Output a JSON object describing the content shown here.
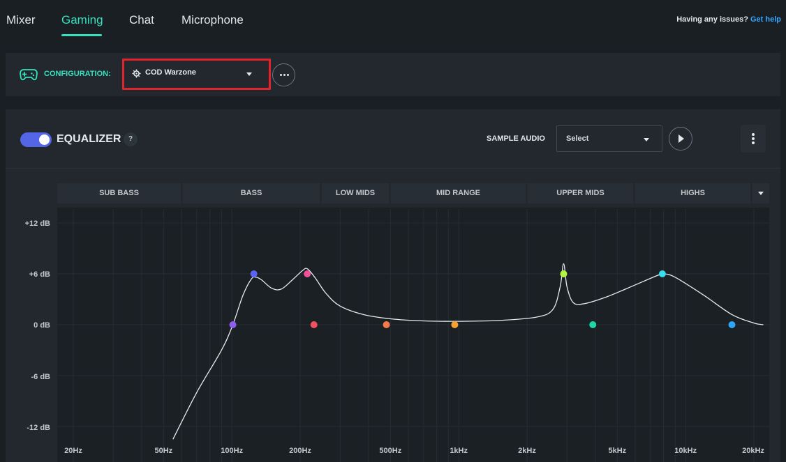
{
  "tabs": [
    {
      "label": "Mixer",
      "active": false
    },
    {
      "label": "Gaming",
      "active": true
    },
    {
      "label": "Chat",
      "active": false
    },
    {
      "label": "Microphone",
      "active": false
    }
  ],
  "help": {
    "text": "Having any issues?",
    "link": "Get help"
  },
  "configuration": {
    "label": "CONFIGURATION:",
    "selected": "COD Warzone",
    "icon": "steelseries-gear-icon",
    "more_icon": "ellipsis-icon"
  },
  "equalizer": {
    "enabled": true,
    "title": "EQUALIZER",
    "help_badge": "?",
    "sample_audio_label": "SAMPLE AUDIO",
    "sample_select": "Select",
    "play_icon": "play-icon",
    "menu_icon": "vertical-dots-icon",
    "bands": [
      "SUB BASS",
      "BASS",
      "LOW MIDS",
      "MID RANGE",
      "UPPER MIDS",
      "HIGHS"
    ],
    "y_labels": [
      "+12 dB",
      "+6 dB",
      "0 dB",
      "-6 dB",
      "-12 dB"
    ],
    "x_labels": [
      "20Hz",
      "50Hz",
      "100Hz",
      "200Hz",
      "500Hz",
      "1kHz",
      "2kHz",
      "5kHz",
      "10kHz",
      "20kHz"
    ],
    "x_label_freqs": [
      20,
      50,
      100,
      200,
      500,
      1000,
      2000,
      5000,
      10000,
      20000
    ],
    "points": [
      {
        "freq": 101,
        "gain": 0,
        "color": "#8f5cf0"
      },
      {
        "freq": 125,
        "gain": 6,
        "color": "#5b63f2"
      },
      {
        "freq": 215,
        "gain": 6,
        "color": "#f2519a"
      },
      {
        "freq": 230,
        "gain": 0,
        "color": "#f45060"
      },
      {
        "freq": 480,
        "gain": 0,
        "color": "#f87a4a"
      },
      {
        "freq": 960,
        "gain": 0,
        "color": "#f8a030"
      },
      {
        "freq": 2900,
        "gain": 6,
        "color": "#b5f542"
      },
      {
        "freq": 3900,
        "gain": 0,
        "color": "#1fd6a9"
      },
      {
        "freq": 7900,
        "gain": 6,
        "color": "#38dcec"
      },
      {
        "freq": 16000,
        "gain": 0,
        "color": "#2fa6f5"
      }
    ],
    "curve": [
      [
        55,
        -13.5
      ],
      [
        70,
        -8
      ],
      [
        90,
        -3
      ],
      [
        101,
        0
      ],
      [
        112,
        3.5
      ],
      [
        122,
        5.4
      ],
      [
        128,
        5.6
      ],
      [
        135,
        5.3
      ],
      [
        150,
        4.3
      ],
      [
        165,
        4.2
      ],
      [
        185,
        5.3
      ],
      [
        205,
        6.4
      ],
      [
        215,
        6.6
      ],
      [
        232,
        5.6
      ],
      [
        260,
        3.7
      ],
      [
        300,
        2.2
      ],
      [
        380,
        1.2
      ],
      [
        500,
        0.7
      ],
      [
        700,
        0.45
      ],
      [
        1000,
        0.4
      ],
      [
        1500,
        0.5
      ],
      [
        2200,
        0.9
      ],
      [
        2600,
        1.8
      ],
      [
        2800,
        4.5
      ],
      [
        2900,
        7.2
      ],
      [
        3000,
        4.5
      ],
      [
        3200,
        2.6
      ],
      [
        3600,
        2.5
      ],
      [
        4500,
        3.3
      ],
      [
        6000,
        4.7
      ],
      [
        7500,
        5.8
      ],
      [
        8000,
        6.0
      ],
      [
        9000,
        5.6
      ],
      [
        12000,
        3.5
      ],
      [
        16000,
        1.2
      ],
      [
        20000,
        0.2
      ],
      [
        22000,
        0
      ]
    ],
    "curve_color": "#e8ecef"
  }
}
